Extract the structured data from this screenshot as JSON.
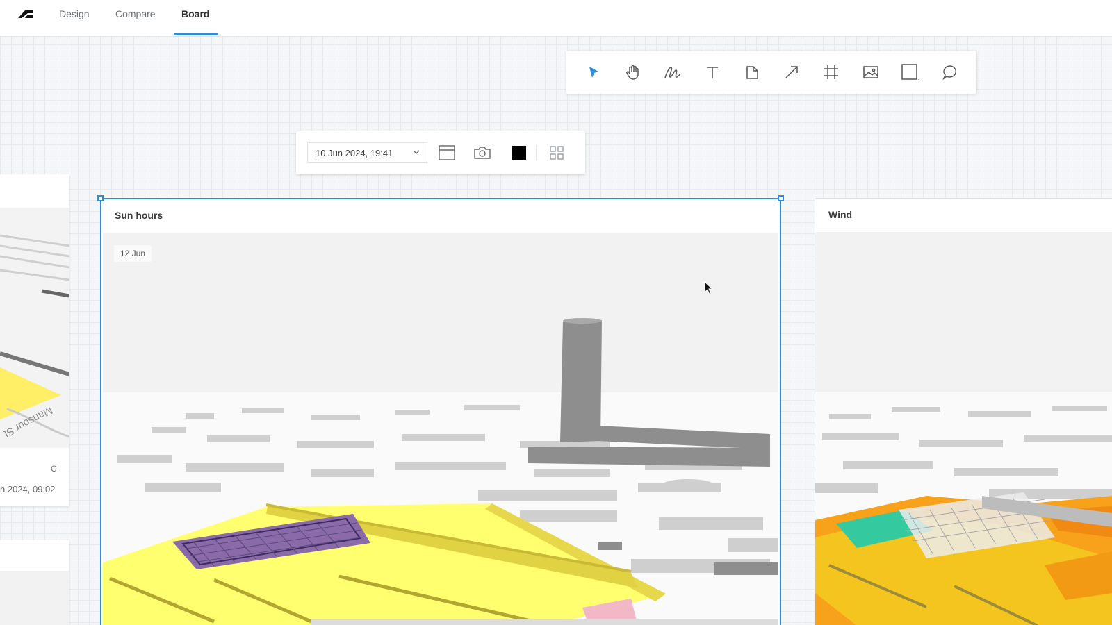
{
  "app": {
    "tabs": [
      {
        "label": "Design"
      },
      {
        "label": "Compare"
      },
      {
        "label": "Board",
        "active": true
      }
    ],
    "accent_color": "#2c8ed6"
  },
  "toolbar": {
    "tools": [
      {
        "name": "select-tool",
        "icon": "pointer-arrow-icon",
        "active": true
      },
      {
        "name": "pan-tool",
        "icon": "hand-icon"
      },
      {
        "name": "draw-tool",
        "icon": "freehand-pen-icon"
      },
      {
        "name": "text-tool",
        "icon": "text-T-icon"
      },
      {
        "name": "note-tool",
        "icon": "sticky-note-icon"
      },
      {
        "name": "arrow-tool",
        "icon": "arrow-icon"
      },
      {
        "name": "frame-tool",
        "icon": "frame-icon"
      },
      {
        "name": "image-tool",
        "icon": "image-icon"
      },
      {
        "name": "shape-tool",
        "icon": "square-icon"
      },
      {
        "name": "comment-tool",
        "icon": "speech-bubble-icon"
      }
    ]
  },
  "context_toolbar": {
    "date_value": "10 Jun 2024, 19:41",
    "buttons": [
      "layout-icon",
      "camera-icon",
      "color-swatch-icon",
      "grid-icon"
    ],
    "swatch_color": "#000000"
  },
  "cards": {
    "left_partial": {
      "date_fragment": "n 2024, 09:02",
      "fragment_letter": "C",
      "street_label": "Mansour St"
    },
    "sun": {
      "title": "Sun hours",
      "date_chip": "12 Jun"
    },
    "wind": {
      "title": "Wind"
    }
  }
}
